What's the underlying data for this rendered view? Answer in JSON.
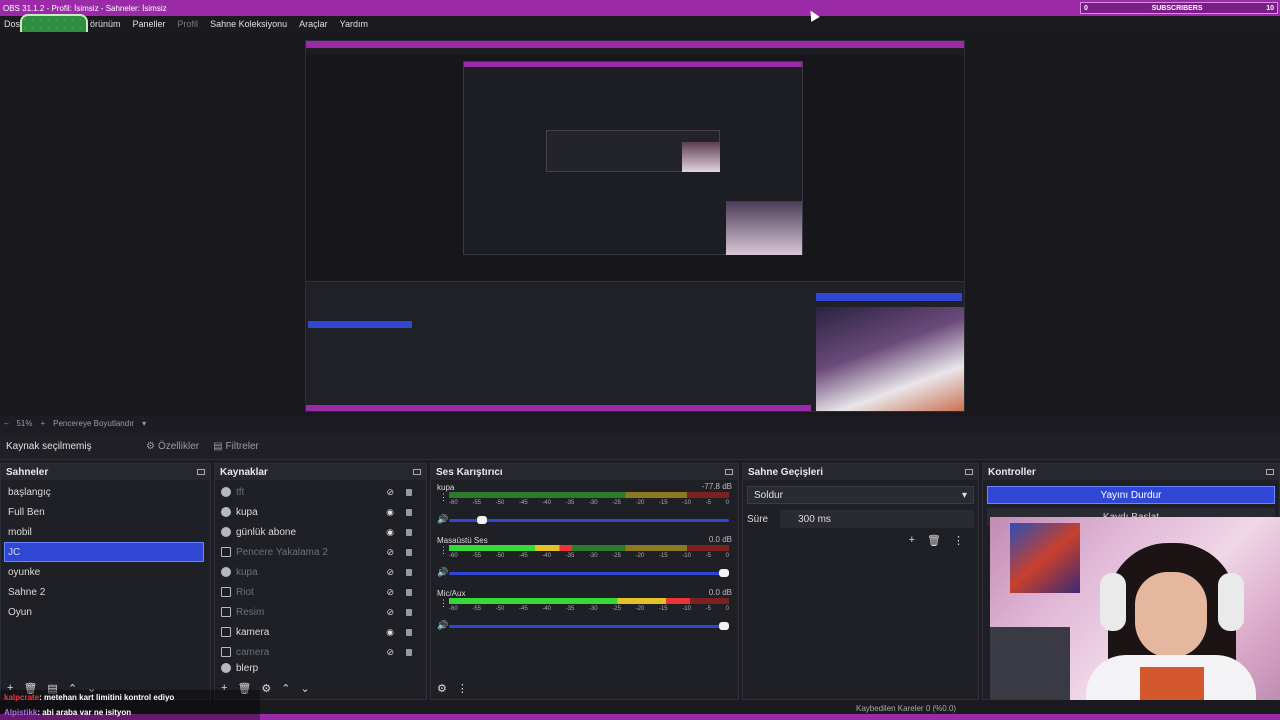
{
  "window": {
    "title": "OBS 31.1.2 - Profil: İsimsiz - Sahneler: İsimsiz"
  },
  "subscriber_widget": {
    "left_count": "0",
    "label": "SUBSCRIBERS",
    "right_count": "10"
  },
  "menu": {
    "items": [
      {
        "label": "Dosya"
      },
      {
        "label": "Görünüm"
      },
      {
        "label": "Paneller"
      },
      {
        "label": "Profil"
      },
      {
        "label": "Sahne Koleksiyonu"
      },
      {
        "label": "Araçlar"
      },
      {
        "label": "Yardım"
      }
    ],
    "visible_first": "Dos",
    "visible_second": "örünüm"
  },
  "preview": {
    "zoom": "51%",
    "resize_mode": "Pencereye Boyutlandır"
  },
  "source_toolbar": {
    "no_source": "Kaynak seçilmemiş",
    "properties": "Özellikler",
    "filters": "Filtreler"
  },
  "scenes": {
    "title": "Sahneler",
    "items": [
      "başlangıç",
      "Full Ben",
      "mobil",
      "JC",
      "oyunke",
      "Sahne 2",
      "Oyun"
    ],
    "selected": "JC"
  },
  "sources": {
    "title": "Kaynaklar",
    "items": [
      {
        "label": "tft",
        "visible": false
      },
      {
        "label": "kupa",
        "visible": true
      },
      {
        "label": "günlük abone",
        "visible": true
      },
      {
        "label": "Pencere Yakalama 2",
        "visible": false
      },
      {
        "label": "kupa",
        "visible": false
      },
      {
        "label": "Riot",
        "visible": false
      },
      {
        "label": "Resim",
        "visible": false
      },
      {
        "label": "kamera",
        "visible": true
      },
      {
        "label": "camera",
        "visible": false
      },
      {
        "label": "blerp",
        "visible": false
      }
    ]
  },
  "mixer": {
    "title": "Ses Karıştırıcı",
    "ticks": [
      "-60",
      "-55",
      "-50",
      "-45",
      "-40",
      "-35",
      "-30",
      "-25",
      "-20",
      "-15",
      "-10",
      "-5",
      "0"
    ],
    "channels": [
      {
        "name": "kupa",
        "db": "-77.8 dB",
        "level": 0.0,
        "volume": 0.1
      },
      {
        "name": "Masaüstü Ses",
        "db": "0.0 dB",
        "level": 0.44,
        "volume": 1.0
      },
      {
        "name": "Mic/Aux",
        "db": "0.0 dB",
        "level": 0.86,
        "volume": 1.0
      }
    ]
  },
  "transitions": {
    "title": "Sahne Geçişleri",
    "selected": "Soldur",
    "duration_label": "Süre",
    "duration_value": "300 ms"
  },
  "controls": {
    "title": "Kontroller",
    "stop_stream": "Yayını Durdur",
    "record": "Kaydı Başlat"
  },
  "status": {
    "dropped_frames": "Kaybedilen Kareler 0 (%0.0)"
  },
  "chat": [
    {
      "user": "kalpcrate",
      "message": ": metehan kart limitini kontrol ediyo"
    },
    {
      "user": "Alpistikk",
      "message": ": abi araba var ne isityon"
    }
  ],
  "colors": {
    "accent_purple": "#9b2aa8",
    "selection_blue": "#2f47d4",
    "panel_bg": "#1f1f26"
  }
}
